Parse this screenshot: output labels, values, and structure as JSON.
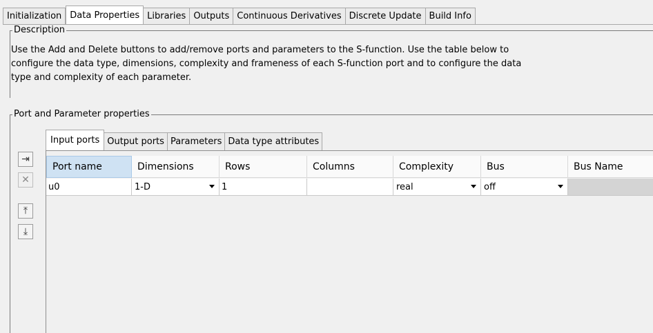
{
  "tabs": [
    "Initialization",
    "Data Properties",
    "Libraries",
    "Outputs",
    "Continuous Derivatives",
    "Discrete Update",
    "Build Info"
  ],
  "active_tab": "Data Properties",
  "description": {
    "legend": "Description",
    "lines": [
      "Use the Add and Delete buttons to add/remove ports and parameters to the S-function. Use the table below to",
      "configure the data type, dimensions, complexity and frameness of each S-function port and to configure the data",
      "type and complexity of each parameter."
    ]
  },
  "port_props": {
    "legend": "Port and Parameter properties",
    "inner_tabs": [
      "Input ports",
      "Output ports",
      "Parameters",
      "Data type attributes"
    ],
    "active_inner_tab": "Input ports",
    "side_buttons": [
      {
        "name": "add-port-icon",
        "glyph": "⇥"
      },
      {
        "name": "delete-port-icon",
        "glyph": "✕"
      },
      {
        "name": "move-up-icon",
        "glyph": "⤒"
      },
      {
        "name": "move-down-icon",
        "glyph": "⤓"
      }
    ],
    "columns": [
      "Port name",
      "Dimensions",
      "Rows",
      "Columns",
      "Complexity",
      "Bus",
      "Bus Name"
    ],
    "rows": [
      {
        "port_name": "u0",
        "dimensions": "1-D",
        "rows": "1",
        "columns": "",
        "complexity": "real",
        "bus": "off",
        "bus_name": ""
      }
    ]
  }
}
